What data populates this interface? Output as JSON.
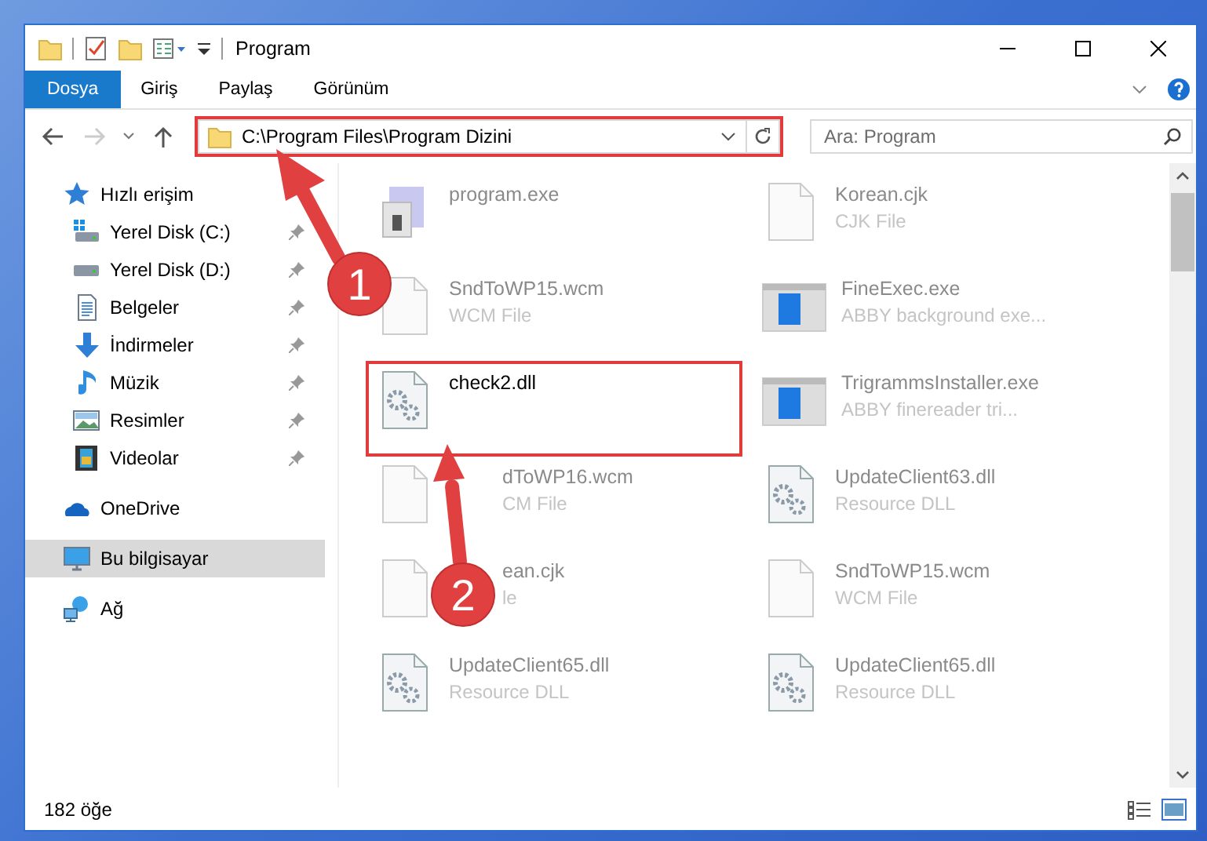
{
  "window": {
    "title": "Program"
  },
  "ribbon_tabs": [
    {
      "label": "Dosya",
      "selected": true
    },
    {
      "label": "Giriş",
      "selected": false
    },
    {
      "label": "Paylaş",
      "selected": false
    },
    {
      "label": "Görünüm",
      "selected": false
    }
  ],
  "address": {
    "path": "C:\\Program Files\\Program Dizini",
    "highlighted": true
  },
  "search": {
    "placeholder": "Ara: Program"
  },
  "sidebar": {
    "items": [
      {
        "label": "Hızlı erişim",
        "kind": "star",
        "selected": false,
        "children": [
          {
            "label": "Yerel Disk (C:)",
            "kind": "windrive",
            "pinned": true,
            "selected": false
          },
          {
            "label": "Yerel Disk (D:)",
            "kind": "drive",
            "pinned": true,
            "selected": false
          },
          {
            "label": "Belgeler",
            "kind": "docs",
            "pinned": true,
            "selected": false
          },
          {
            "label": "İndirmeler",
            "kind": "download",
            "pinned": true,
            "selected": false
          },
          {
            "label": "Müzik",
            "kind": "music",
            "pinned": true,
            "selected": false
          },
          {
            "label": "Resimler",
            "kind": "pictures",
            "pinned": true,
            "selected": false
          },
          {
            "label": "Videolar",
            "kind": "video",
            "pinned": true,
            "selected": false
          }
        ]
      },
      {
        "label": "OneDrive",
        "kind": "cloud",
        "selected": false
      },
      {
        "label": "Bu bilgisayar",
        "kind": "pc",
        "selected": true
      },
      {
        "label": "Ağ",
        "kind": "network",
        "selected": false
      }
    ]
  },
  "files": [
    {
      "name": "program.exe",
      "kind": "exe",
      "dimmed": true,
      "highlighted": false
    },
    {
      "name": "Korean.cjk",
      "type": "CJK File",
      "kind": "blank",
      "dimmed": true,
      "highlighted": false
    },
    {
      "name": "SndToWP15.wcm",
      "type": "WCM File",
      "kind": "blank",
      "dimmed": true,
      "highlighted": false
    },
    {
      "name": "FineExec.exe",
      "type": "ABBY background exe...",
      "kind": "app",
      "dimmed": true,
      "highlighted": false
    },
    {
      "name": "check2.dll",
      "kind": "dll",
      "dimmed": false,
      "highlighted": true
    },
    {
      "name": "TrigrammsInstaller.exe",
      "type": "ABBY finereader tri...",
      "kind": "app",
      "dimmed": true,
      "highlighted": false
    },
    {
      "name": "dToWP16.wcm",
      "type": "CM File",
      "kind": "blank",
      "dimmed": true,
      "highlighted": false,
      "covered": true
    },
    {
      "name": "UpdateClient63.dll",
      "type": "Resource DLL",
      "kind": "dll",
      "dimmed": true,
      "highlighted": false
    },
    {
      "name": "ean.cjk",
      "type": "le",
      "kind": "blank",
      "dimmed": true,
      "highlighted": false,
      "covered": true
    },
    {
      "name": "SndToWP15.wcm",
      "type": "WCM File",
      "kind": "blank",
      "dimmed": true,
      "highlighted": false
    },
    {
      "name": "UpdateClient65.dll",
      "type": "Resource DLL",
      "kind": "dll",
      "dimmed": true,
      "highlighted": false
    },
    {
      "name": "UpdateClient65.dll",
      "type": "Resource DLL",
      "kind": "dll",
      "dimmed": true,
      "highlighted": false
    }
  ],
  "status_bar": {
    "count": "182 öğe"
  },
  "annotations": [
    {
      "number": "1"
    },
    {
      "number": "2"
    }
  ]
}
